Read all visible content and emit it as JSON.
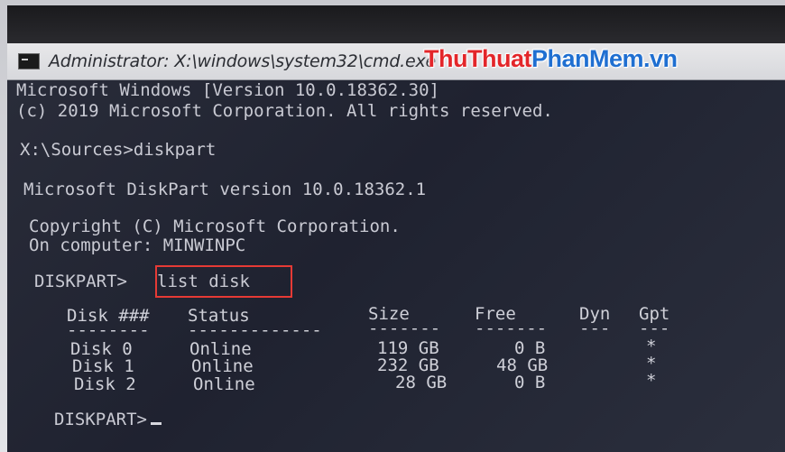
{
  "window": {
    "title": "Administrator: X:\\windows\\system32\\cmd.exe"
  },
  "watermark": {
    "part1": "ThuThuat",
    "part2": "PhanMem",
    "part3": ".vn"
  },
  "console": {
    "lines": [
      "Microsoft Windows [Version 10.0.18362.30]",
      "(c) 2019 Microsoft Corporation. All rights reserved.",
      "X:\\Sources>diskpart",
      "Microsoft DiskPart version 10.0.18362.1",
      "Copyright (C) Microsoft Corporation.",
      "On computer: MINWINPC"
    ],
    "prompt1": "DISKPART>",
    "command": "list disk",
    "prompt2": "DISKPART>"
  },
  "table": {
    "headers": [
      "Disk ###",
      "Status",
      "Size",
      "Free",
      "Dyn",
      "Gpt"
    ],
    "separators": [
      "--------",
      "-------------",
      "-------",
      "-------",
      "---",
      "---"
    ],
    "rows": [
      [
        "Disk 0",
        "Online",
        "119 GB",
        "0 B",
        "",
        "*"
      ],
      [
        "Disk 1",
        "Online",
        "232 GB",
        "48 GB",
        "",
        "*"
      ],
      [
        "Disk 2",
        "Online",
        "28 GB",
        "0 B",
        "",
        "*"
      ]
    ]
  },
  "colors": {
    "highlight_box": "#e63a35",
    "console_bg": "#1f2230",
    "console_text": "#c9cad3"
  }
}
